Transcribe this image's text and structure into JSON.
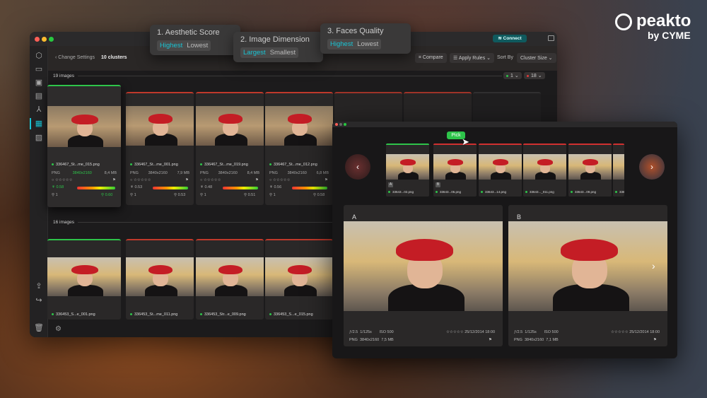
{
  "logo": {
    "name": "peakto",
    "by": "by CYME"
  },
  "sort_popups": [
    {
      "title": "1. Aesthetic Score",
      "options": [
        "Highest",
        "Lowest"
      ],
      "selected": "Highest"
    },
    {
      "title": "2. Image Dimension",
      "options": [
        "Largest",
        "Smallest"
      ],
      "selected": "Largest"
    },
    {
      "title": "3. Faces Quality",
      "options": [
        "Highest",
        "Lowest"
      ],
      "selected": "Highest"
    }
  ],
  "titlebar": {
    "connect": "Connect"
  },
  "toolbar": {
    "back": "Change Settings",
    "clusters": "10 clusters",
    "compare": "Compare",
    "apply_rules": "Apply Rules",
    "sort_by": "Sort By",
    "sort_value": "Cluster Size"
  },
  "cluster1": {
    "count": "19 images",
    "picked": "1",
    "rejected": "18",
    "cards": [
      {
        "name": "336467_St...me_015.png",
        "format": "PNG",
        "dim": "3840x2160",
        "size": "8,4 MB",
        "score": "0.58",
        "people": "1",
        "face": "0.60"
      },
      {
        "name": "336467_St...me_001.png",
        "format": "PNG",
        "dim": "3840x2160",
        "size": "7,9 MB",
        "score": "0.53",
        "people": "1",
        "face": "0.53"
      },
      {
        "name": "336467_St...me_019.png",
        "format": "PNG",
        "dim": "3840x2160",
        "size": "8,4 MB",
        "score": "0.48",
        "people": "1",
        "face": "0.51"
      },
      {
        "name": "336467_St...me_012.png",
        "format": "PNG",
        "dim": "3840x2160",
        "size": "6,8 MB",
        "score": "0.56",
        "people": "1",
        "face": "0.58"
      }
    ]
  },
  "cluster2": {
    "count": "16 images",
    "cards": [
      {
        "name": "336453_S...e_001.png"
      },
      {
        "name": "336453_St...me_011.png"
      },
      {
        "name": "336453_Str...e_009.png"
      },
      {
        "name": "336453_S...e_015.png"
      }
    ]
  },
  "compare": {
    "pick": "Pick",
    "thumbs": [
      {
        "name": "33643...02.png",
        "badge": "A"
      },
      {
        "name": "33643...05.png",
        "badge": "B"
      },
      {
        "name": "33643...14.png"
      },
      {
        "name": "33643..._011.png"
      },
      {
        "name": "33643...09.png"
      },
      {
        "name": "3364"
      }
    ],
    "panels": [
      {
        "label": "A",
        "aperture": "ƒ/2.5",
        "shutter": "1/125s",
        "iso": "ISO 500",
        "date": "25/12/2014 18:00",
        "format": "PNG",
        "dim": "3840x2160",
        "size": "7,5 MB"
      },
      {
        "label": "B",
        "aperture": "ƒ/2.5",
        "shutter": "1/125s",
        "iso": "ISO 500",
        "date": "25/12/2014 18:00",
        "format": "PNG",
        "dim": "3840x2160",
        "size": "7,1 MB"
      }
    ]
  },
  "stars": "☆☆☆☆☆",
  "colors": {
    "accent": "#19c4d4",
    "pick": "#2ec44a",
    "reject": "#e03a3a"
  }
}
